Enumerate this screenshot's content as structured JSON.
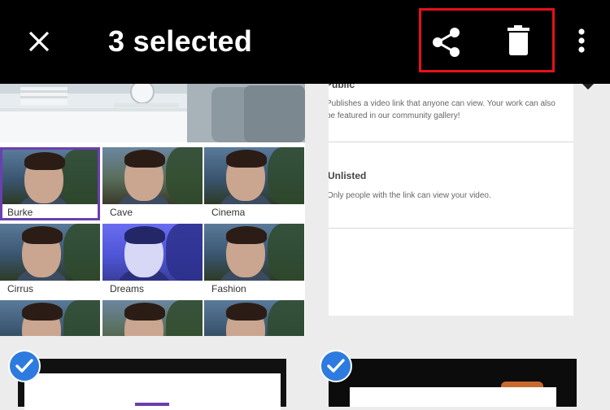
{
  "header": {
    "title": "3 selected",
    "close_icon": "close-icon",
    "share_icon": "share-icon",
    "delete_icon": "trash-icon",
    "more_icon": "more-vertical-icon",
    "highlight_color": "#e8101a"
  },
  "filters": [
    {
      "label": "Burke",
      "selected": true
    },
    {
      "label": "Cave",
      "selected": false
    },
    {
      "label": "Cinema",
      "selected": false
    },
    {
      "label": "Cirrus",
      "selected": false
    },
    {
      "label": "Dreams",
      "selected": false
    },
    {
      "label": "Fashion",
      "selected": false
    },
    {
      "label": "",
      "selected": false
    },
    {
      "label": "",
      "selected": false
    },
    {
      "label": "",
      "selected": false
    }
  ],
  "visibility": {
    "public_title": "Public",
    "public_desc": "Publishes a video link that anyone can view. Your work can also be featured in our community gallery!",
    "unlisted_title": "Unlisted",
    "unlisted_desc": "Only people with the link can view your video."
  },
  "selection": {
    "check_icon": "checkmark-icon",
    "check_color": "#2e7be0",
    "selected_filter_color": "#6a3fb0"
  }
}
